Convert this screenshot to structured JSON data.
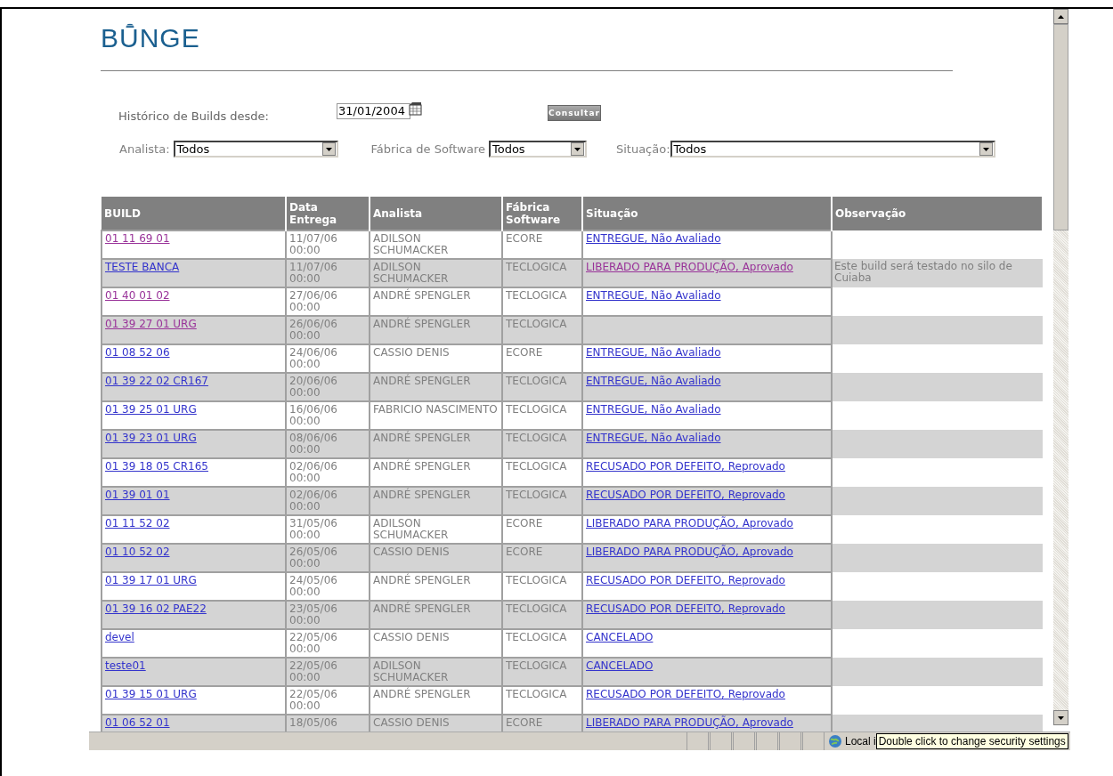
{
  "logo": {
    "text": "BUNGE"
  },
  "filters": {
    "since_label": "Histórico de Builds desde:",
    "since_date": "31/01/2004",
    "submit": "Consultar",
    "analista_label": "Analista:",
    "analista_value": "Todos",
    "fabrica_label": "Fábrica de Software",
    "fabrica_value": "Todos",
    "situacao_label": "Situação:",
    "situacao_value": "Todos"
  },
  "table": {
    "columns": [
      "BUILD",
      "Data Entrega",
      "Analista",
      "Fábrica Software",
      "Situação",
      "Observação"
    ],
    "rows": [
      {
        "build": "01 11 69 01",
        "build_visited": true,
        "date": "11/07/06 00:00",
        "analista": "ADILSON SCHUMACKER",
        "fabrica": "ECORE",
        "situacao": "ENTREGUE, Não Avaliado",
        "situacao_visited": false
      },
      {
        "build": "TESTE BANCA",
        "build_visited": false,
        "date": "11/07/06 00:00",
        "analista": "ADILSON SCHUMACKER",
        "fabrica": "TECLOGICA",
        "situacao": "LIBERADO PARA PRODUÇÃO, Aprovado",
        "situacao_visited": true,
        "observacao": "Este build será testado no silo de Cuiaba"
      },
      {
        "build": "01 40 01 02",
        "build_visited": true,
        "date": "27/06/06 00:00",
        "analista": "ANDRÉ SPENGLER",
        "fabrica": "TECLOGICA",
        "situacao": "ENTREGUE, Não Avaliado",
        "situacao_visited": false
      },
      {
        "build": "01 39 27 01 URG",
        "build_visited": true,
        "date": "26/06/06 00:00",
        "analista": "ANDRÉ SPENGLER",
        "fabrica": "TECLOGICA"
      },
      {
        "build": "01 08 52 06",
        "build_visited": false,
        "date": "24/06/06 00:00",
        "analista": "CASSIO DENIS",
        "fabrica": "ECORE",
        "situacao": "ENTREGUE, Não Avaliado",
        "situacao_visited": false
      },
      {
        "build": "01 39 22 02 CR167",
        "build_visited": false,
        "date": "20/06/06 00:00",
        "analista": "ANDRÉ SPENGLER",
        "fabrica": "TECLOGICA",
        "situacao": "ENTREGUE, Não Avaliado",
        "situacao_visited": false
      },
      {
        "build": "01 39 25 01 URG",
        "build_visited": false,
        "date": "16/06/06 00:00",
        "analista": "FABRICIO NASCIMENTO",
        "fabrica": "TECLOGICA",
        "situacao": "ENTREGUE, Não Avaliado",
        "situacao_visited": false
      },
      {
        "build": "01 39 23 01 URG",
        "build_visited": false,
        "date": "08/06/06 00:00",
        "analista": "ANDRÉ SPENGLER",
        "fabrica": "TECLOGICA",
        "situacao": "ENTREGUE, Não Avaliado",
        "situacao_visited": false
      },
      {
        "build": "01 39 18 05 CR165",
        "build_visited": false,
        "date": "02/06/06 00:00",
        "analista": "ANDRÉ SPENGLER",
        "fabrica": "TECLOGICA",
        "situacao": "RECUSADO POR DEFEITO, Reprovado",
        "situacao_visited": false
      },
      {
        "build": "01 39 01 01",
        "build_visited": false,
        "date": "02/06/06 00:00",
        "analista": "ANDRÉ SPENGLER",
        "fabrica": "TECLOGICA",
        "situacao": "RECUSADO POR DEFEITO, Reprovado",
        "situacao_visited": false
      },
      {
        "build": "01 11 52 02",
        "build_visited": false,
        "date": "31/05/06 00:00",
        "analista": "ADILSON SCHUMACKER",
        "fabrica": "ECORE",
        "situacao": "LIBERADO PARA PRODUÇÃO, Aprovado",
        "situacao_visited": false
      },
      {
        "build": "01 10 52 02",
        "build_visited": false,
        "date": "26/05/06 00:00",
        "analista": "CASSIO DENIS",
        "fabrica": "ECORE",
        "situacao": "LIBERADO PARA PRODUÇÃO, Aprovado",
        "situacao_visited": false
      },
      {
        "build": "01 39 17 01 URG",
        "build_visited": false,
        "date": "24/05/06 00:00",
        "analista": "ANDRÉ SPENGLER",
        "fabrica": "TECLOGICA",
        "situacao": "RECUSADO POR DEFEITO, Reprovado",
        "situacao_visited": false
      },
      {
        "build": "01 39 16 02 PAE22",
        "build_visited": false,
        "date": "23/05/06 00:00",
        "analista": "ANDRÉ SPENGLER",
        "fabrica": "TECLOGICA",
        "situacao": "RECUSADO POR DEFEITO, Reprovado",
        "situacao_visited": false
      },
      {
        "build": "devel",
        "build_visited": false,
        "date": "22/05/06 00:00",
        "analista": "CASSIO DENIS",
        "fabrica": "TECLOGICA",
        "situacao": "CANCELADO",
        "situacao_visited": false
      },
      {
        "build": "teste01",
        "build_visited": false,
        "date": "22/05/06 00:00",
        "analista": "ADILSON SCHUMACKER",
        "fabrica": "TECLOGICA",
        "situacao": "CANCELADO",
        "situacao_visited": false
      },
      {
        "build": "01 39 15 01 URG",
        "build_visited": false,
        "date": "22/05/06 00:00",
        "analista": "ANDRÉ SPENGLER",
        "fabrica": "TECLOGICA",
        "situacao": "RECUSADO POR DEFEITO, Reprovado",
        "situacao_visited": false
      },
      {
        "build": "01 06 52 01",
        "build_visited": false,
        "date": "18/05/06",
        "analista": "CASSIO DENIS",
        "fabrica": "ECORE",
        "situacao": "LIBERADO PARA PRODUÇÃO, Aprovado",
        "situacao_visited": false
      }
    ]
  },
  "status_bar": {
    "zone": "Local i",
    "tooltip": "Double click to change security settings"
  }
}
